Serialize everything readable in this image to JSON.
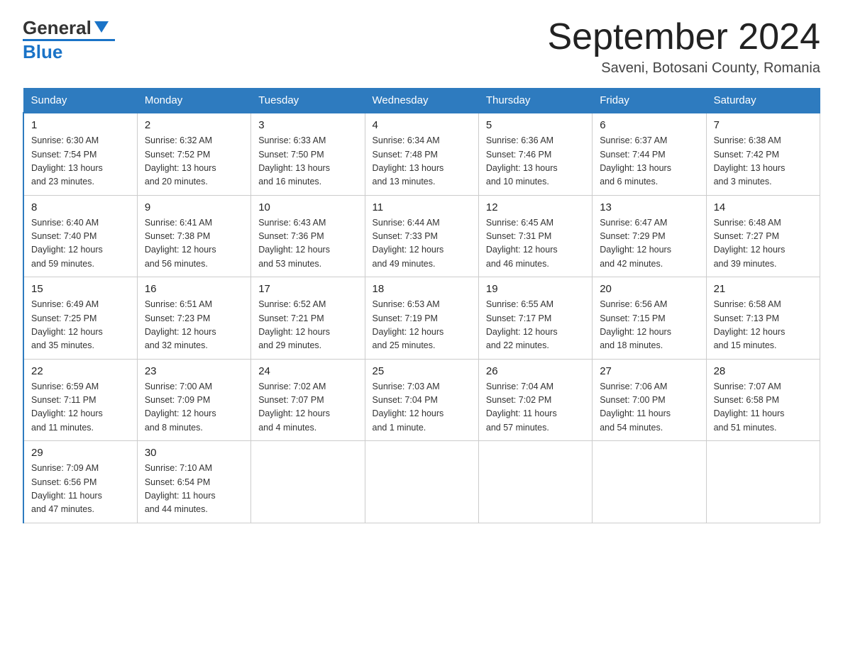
{
  "header": {
    "logo_text_black": "General",
    "logo_text_blue": "Blue",
    "month_year": "September 2024",
    "location": "Saveni, Botosani County, Romania"
  },
  "days_of_week": [
    "Sunday",
    "Monday",
    "Tuesday",
    "Wednesday",
    "Thursday",
    "Friday",
    "Saturday"
  ],
  "weeks": [
    [
      {
        "day": 1,
        "info": "Sunrise: 6:30 AM\nSunset: 7:54 PM\nDaylight: 13 hours\nand 23 minutes."
      },
      {
        "day": 2,
        "info": "Sunrise: 6:32 AM\nSunset: 7:52 PM\nDaylight: 13 hours\nand 20 minutes."
      },
      {
        "day": 3,
        "info": "Sunrise: 6:33 AM\nSunset: 7:50 PM\nDaylight: 13 hours\nand 16 minutes."
      },
      {
        "day": 4,
        "info": "Sunrise: 6:34 AM\nSunset: 7:48 PM\nDaylight: 13 hours\nand 13 minutes."
      },
      {
        "day": 5,
        "info": "Sunrise: 6:36 AM\nSunset: 7:46 PM\nDaylight: 13 hours\nand 10 minutes."
      },
      {
        "day": 6,
        "info": "Sunrise: 6:37 AM\nSunset: 7:44 PM\nDaylight: 13 hours\nand 6 minutes."
      },
      {
        "day": 7,
        "info": "Sunrise: 6:38 AM\nSunset: 7:42 PM\nDaylight: 13 hours\nand 3 minutes."
      }
    ],
    [
      {
        "day": 8,
        "info": "Sunrise: 6:40 AM\nSunset: 7:40 PM\nDaylight: 12 hours\nand 59 minutes."
      },
      {
        "day": 9,
        "info": "Sunrise: 6:41 AM\nSunset: 7:38 PM\nDaylight: 12 hours\nand 56 minutes."
      },
      {
        "day": 10,
        "info": "Sunrise: 6:43 AM\nSunset: 7:36 PM\nDaylight: 12 hours\nand 53 minutes."
      },
      {
        "day": 11,
        "info": "Sunrise: 6:44 AM\nSunset: 7:33 PM\nDaylight: 12 hours\nand 49 minutes."
      },
      {
        "day": 12,
        "info": "Sunrise: 6:45 AM\nSunset: 7:31 PM\nDaylight: 12 hours\nand 46 minutes."
      },
      {
        "day": 13,
        "info": "Sunrise: 6:47 AM\nSunset: 7:29 PM\nDaylight: 12 hours\nand 42 minutes."
      },
      {
        "day": 14,
        "info": "Sunrise: 6:48 AM\nSunset: 7:27 PM\nDaylight: 12 hours\nand 39 minutes."
      }
    ],
    [
      {
        "day": 15,
        "info": "Sunrise: 6:49 AM\nSunset: 7:25 PM\nDaylight: 12 hours\nand 35 minutes."
      },
      {
        "day": 16,
        "info": "Sunrise: 6:51 AM\nSunset: 7:23 PM\nDaylight: 12 hours\nand 32 minutes."
      },
      {
        "day": 17,
        "info": "Sunrise: 6:52 AM\nSunset: 7:21 PM\nDaylight: 12 hours\nand 29 minutes."
      },
      {
        "day": 18,
        "info": "Sunrise: 6:53 AM\nSunset: 7:19 PM\nDaylight: 12 hours\nand 25 minutes."
      },
      {
        "day": 19,
        "info": "Sunrise: 6:55 AM\nSunset: 7:17 PM\nDaylight: 12 hours\nand 22 minutes."
      },
      {
        "day": 20,
        "info": "Sunrise: 6:56 AM\nSunset: 7:15 PM\nDaylight: 12 hours\nand 18 minutes."
      },
      {
        "day": 21,
        "info": "Sunrise: 6:58 AM\nSunset: 7:13 PM\nDaylight: 12 hours\nand 15 minutes."
      }
    ],
    [
      {
        "day": 22,
        "info": "Sunrise: 6:59 AM\nSunset: 7:11 PM\nDaylight: 12 hours\nand 11 minutes."
      },
      {
        "day": 23,
        "info": "Sunrise: 7:00 AM\nSunset: 7:09 PM\nDaylight: 12 hours\nand 8 minutes."
      },
      {
        "day": 24,
        "info": "Sunrise: 7:02 AM\nSunset: 7:07 PM\nDaylight: 12 hours\nand 4 minutes."
      },
      {
        "day": 25,
        "info": "Sunrise: 7:03 AM\nSunset: 7:04 PM\nDaylight: 12 hours\nand 1 minute."
      },
      {
        "day": 26,
        "info": "Sunrise: 7:04 AM\nSunset: 7:02 PM\nDaylight: 11 hours\nand 57 minutes."
      },
      {
        "day": 27,
        "info": "Sunrise: 7:06 AM\nSunset: 7:00 PM\nDaylight: 11 hours\nand 54 minutes."
      },
      {
        "day": 28,
        "info": "Sunrise: 7:07 AM\nSunset: 6:58 PM\nDaylight: 11 hours\nand 51 minutes."
      }
    ],
    [
      {
        "day": 29,
        "info": "Sunrise: 7:09 AM\nSunset: 6:56 PM\nDaylight: 11 hours\nand 47 minutes."
      },
      {
        "day": 30,
        "info": "Sunrise: 7:10 AM\nSunset: 6:54 PM\nDaylight: 11 hours\nand 44 minutes."
      },
      {
        "day": null,
        "info": ""
      },
      {
        "day": null,
        "info": ""
      },
      {
        "day": null,
        "info": ""
      },
      {
        "day": null,
        "info": ""
      },
      {
        "day": null,
        "info": ""
      }
    ]
  ]
}
